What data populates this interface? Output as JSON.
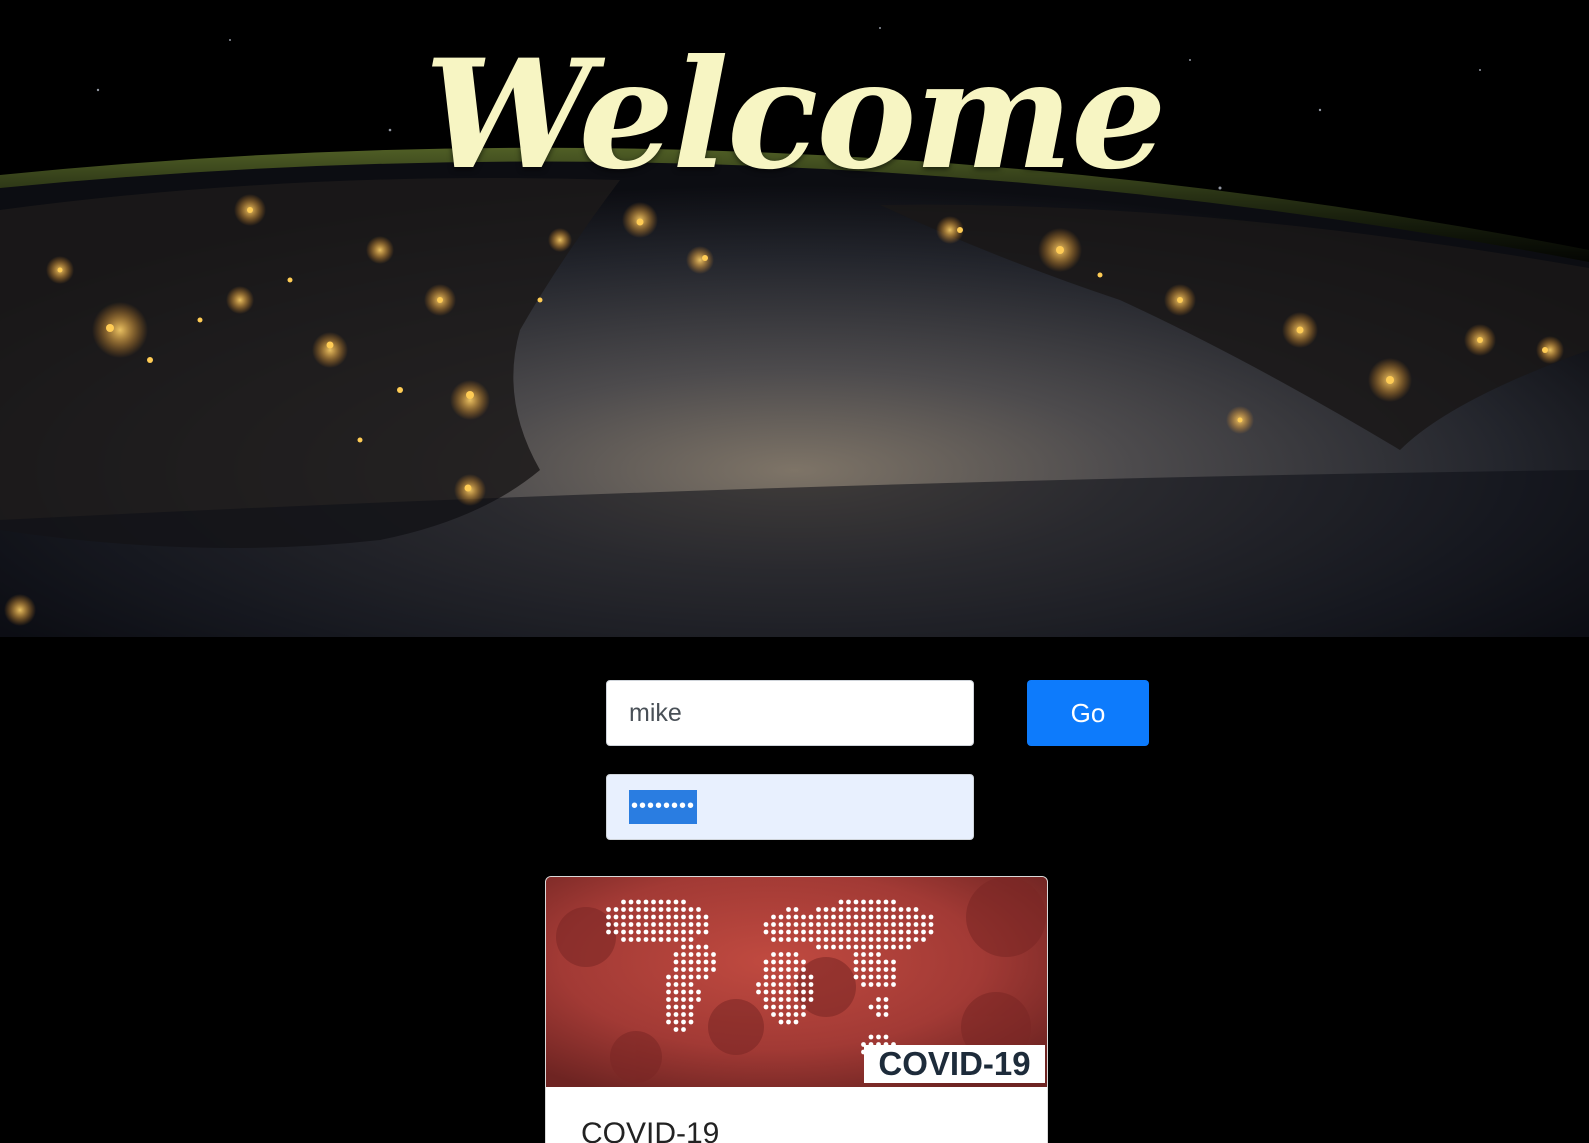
{
  "hero": {
    "title": "Welcome"
  },
  "login": {
    "username_value": "mike",
    "password_mask": "••••••••",
    "go_label": "Go"
  },
  "card": {
    "image_badge": "COVID-19",
    "title": "COVID-19"
  },
  "icons": {
    "hero_image": "earth-at-night-image",
    "card_image": "world-map-virus-image"
  },
  "colors": {
    "background": "#000000",
    "title": "#f7f5c3",
    "go_button": "#0d7bfc",
    "password_fill": "#e8f0fe",
    "selection": "#2a7de1",
    "card_image": "#9e3431"
  }
}
